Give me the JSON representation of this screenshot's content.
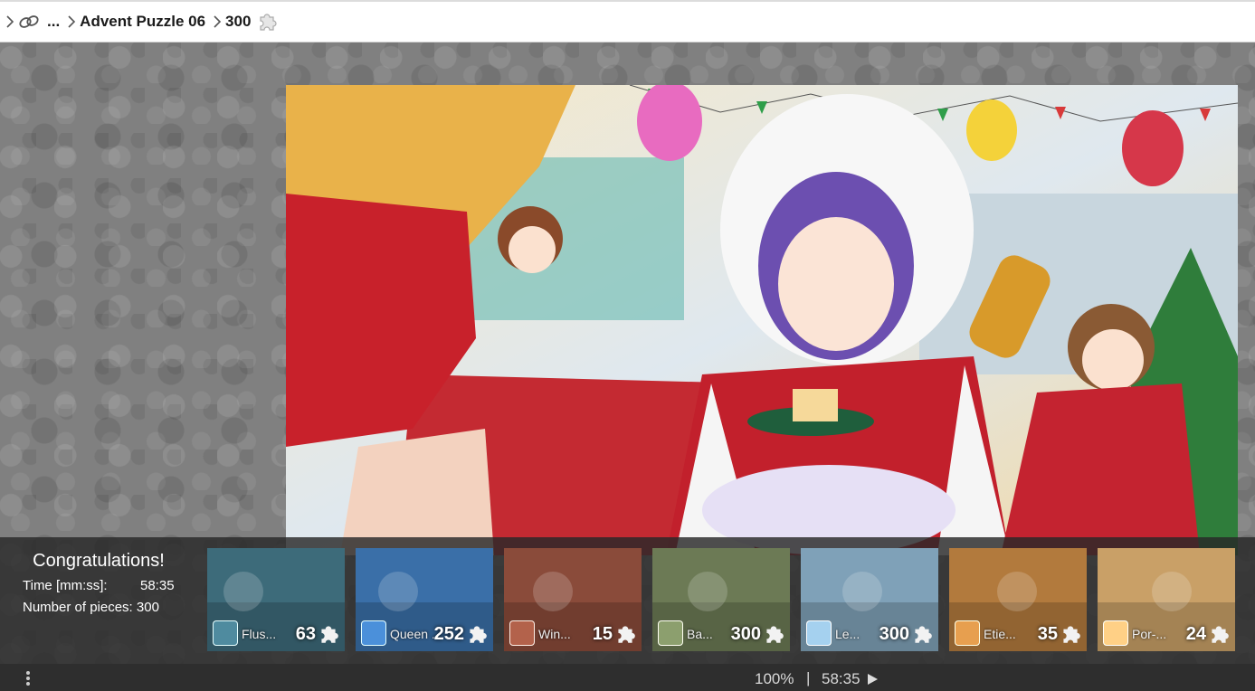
{
  "breadcrumb": {
    "ellipsis": "...",
    "title": "Advent Puzzle 06",
    "pieces": "300"
  },
  "completion": {
    "heading": "Congratulations!",
    "time_label": "Time [mm:ss]:",
    "time_value": "58:35",
    "pieces_label": "Number of pieces: 300"
  },
  "thumbnails": [
    {
      "name": "Flus...",
      "count": "63",
      "color": "#3d6b7a"
    },
    {
      "name": "Queen ...",
      "count": "252",
      "color": "#3a6fa8"
    },
    {
      "name": "Win...",
      "count": "15",
      "color": "#8a4b3a"
    },
    {
      "name": "Ba...",
      "count": "300",
      "color": "#6c7a55"
    },
    {
      "name": "Le...",
      "count": "300",
      "color": "#7fa1b8"
    },
    {
      "name": "Etie...",
      "count": "35",
      "color": "#b27a3d"
    },
    {
      "name": "Por-...",
      "count": "24",
      "color": "#c9a067"
    }
  ],
  "status": {
    "zoom": "100%",
    "divider": "|",
    "timer": "58:35"
  },
  "icons": [
    "chevron-right-icon",
    "link-icon",
    "puzzle-piece-icon",
    "menu-dots-icon",
    "play-icon"
  ]
}
